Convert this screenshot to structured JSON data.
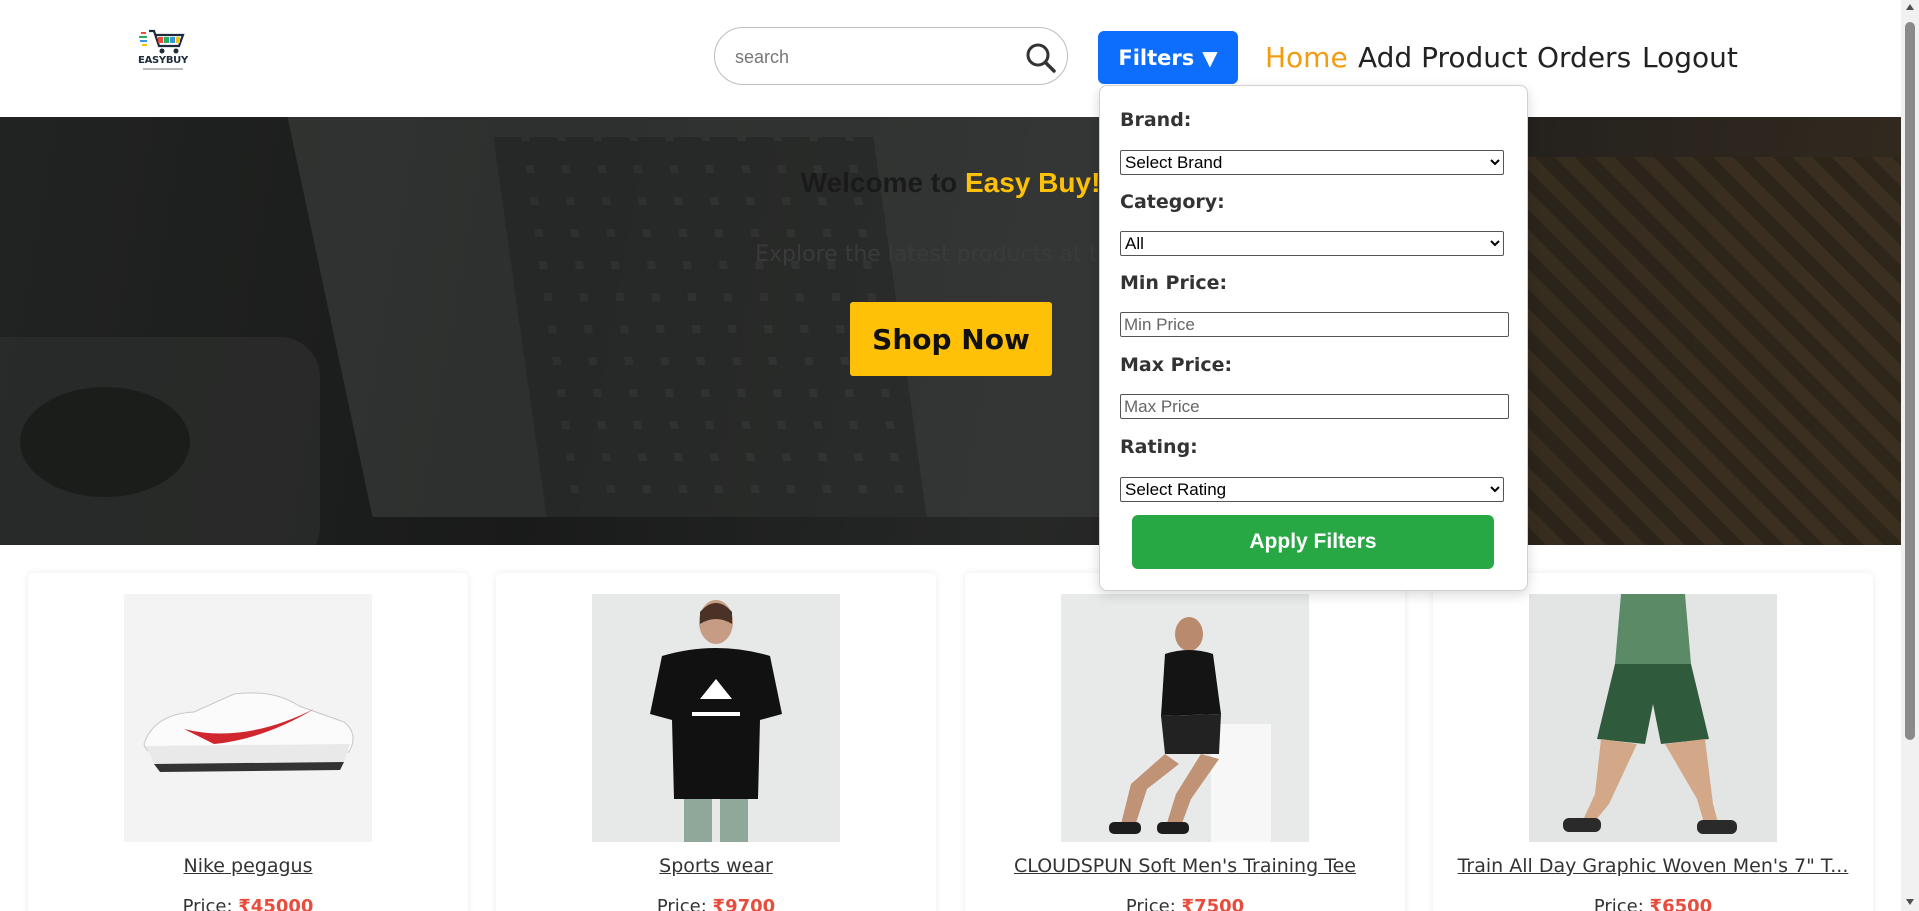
{
  "header": {
    "logo_text": "EASYBUY",
    "search_placeholder": "search",
    "filters_label": "Filters",
    "filters_caret": "▼",
    "nav": [
      "Home",
      "Add Product",
      "Orders",
      "Logout"
    ],
    "active_nav": "Home"
  },
  "hero": {
    "welcome_prefix": "Welcome to",
    "brand": "Easy Buy!",
    "subtitle": "Explore the latest products at the b",
    "cta": "Shop Now"
  },
  "filters": {
    "brand_label": "Brand:",
    "brand_value": "Select Brand",
    "category_label": "Category:",
    "category_value": "All",
    "min_label": "Min Price:",
    "min_placeholder": "Min Price",
    "max_label": "Max Price:",
    "max_placeholder": "Max Price",
    "rating_label": "Rating:",
    "rating_value": "Select Rating",
    "apply_label": "Apply Filters"
  },
  "products": [
    {
      "name": "Nike pegagus",
      "price_label": "Price:",
      "price": "₹45000"
    },
    {
      "name": "Sports wear",
      "price_label": "Price:",
      "price": "₹9700"
    },
    {
      "name": "CLOUDSPUN Soft Men's Training Tee",
      "price_label": "Price:",
      "price": "₹7500"
    },
    {
      "name": "Train All Day Graphic Woven Men's 7\" T...",
      "price_label": "Price:",
      "price": "₹6500"
    }
  ],
  "colors": {
    "primary_blue": "#0d6efd",
    "accent_yellow": "#ffc107",
    "apply_green": "#28a745",
    "nav_active": "#f39c12",
    "price_red": "#e74c3c"
  }
}
